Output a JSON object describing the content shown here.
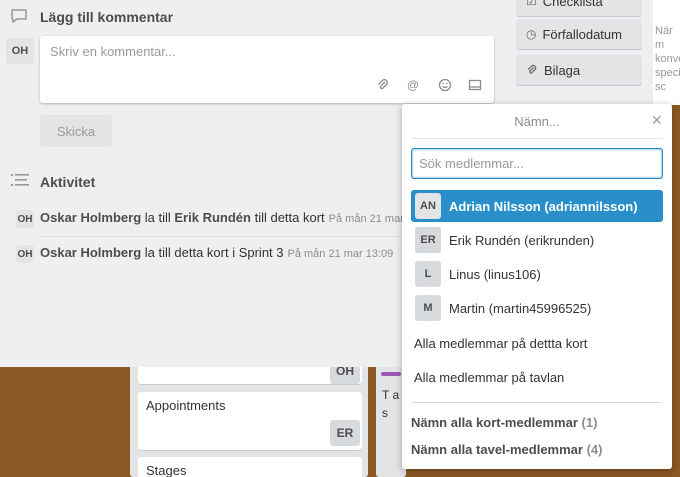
{
  "card": {
    "comment": {
      "title": "Lägg till kommentar",
      "avatar": "OH",
      "placeholder": "Skriv en kommentar...",
      "send_label": "Skicka"
    },
    "activity": {
      "title": "Aktivitet",
      "entries": [
        {
          "avatar": "OH",
          "user": "Oskar Holmberg",
          "text1": " la till ",
          "target": "Erik Rundén",
          "text2": " till detta kort",
          "time": "På mån 21 mar"
        },
        {
          "avatar": "OH",
          "user": "Oskar Holmberg",
          "text1": " la till detta kort i Sprint 3",
          "target": "",
          "text2": "",
          "time": "På mån 21 mar 13:09"
        }
      ]
    },
    "sidebar": {
      "top_label": "Checklista",
      "due_label": "Förfallodatum",
      "attach_label": "Bilaga"
    },
    "right_strip_text": "När m konve specif sc"
  },
  "board": {
    "cards": [
      {
        "label": "Appointments",
        "member": "ER"
      },
      {
        "label": "Stages",
        "member": ""
      }
    ],
    "oh_avatar": "OH",
    "side_text": "T a s"
  },
  "mention": {
    "title": "Nämn...",
    "search_placeholder": "Sök medlemmar...",
    "members": [
      {
        "initials": "AN",
        "name": "Adrian Nilsson (adriannilsson)",
        "selected": true
      },
      {
        "initials": "ER",
        "name": "Erik Rundén (erikrunden)",
        "selected": false
      },
      {
        "initials": "L",
        "name": "Linus (linus106)",
        "selected": false
      },
      {
        "initials": "M",
        "name": "Martin (martin45996525)",
        "selected": false
      }
    ],
    "all_on_card": "Alla medlemmar på dettta kort",
    "all_on_board": "Alla medlemmar på tavlan",
    "mention_card_label": "Nämn alla kort-medlemmar",
    "mention_card_count": "(1)",
    "mention_board_label": "Nämn alla tavel-medlemmar",
    "mention_board_count": "(4)"
  },
  "colors": {
    "accent": "#298fca",
    "board_bg": "#8b5a24"
  }
}
